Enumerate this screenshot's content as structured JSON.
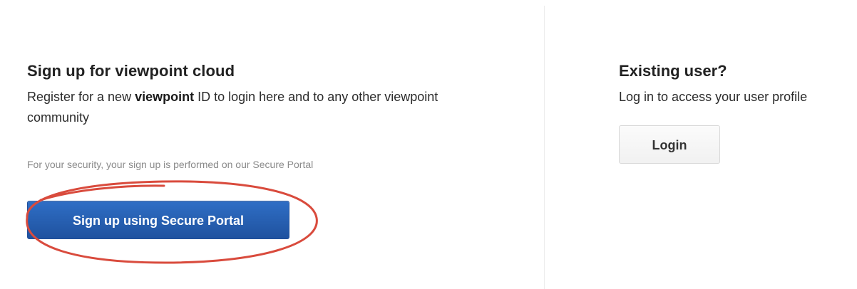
{
  "signup": {
    "title": "Sign up for viewpoint cloud",
    "description_prefix": "Register for a new ",
    "description_bold": "viewpoint",
    "description_suffix": " ID to login here and to any other viewpoint community",
    "security_note": "For your security, your sign up is performed on our Secure Portal",
    "button_label": "Sign up using Secure Portal"
  },
  "existing_user": {
    "title": "Existing user?",
    "description": "Log in to access your user profile",
    "button_label": "Login"
  },
  "colors": {
    "primary_button": "#2f6ec5",
    "annotation_ellipse": "#d94b3d",
    "divider": "#ececec"
  }
}
